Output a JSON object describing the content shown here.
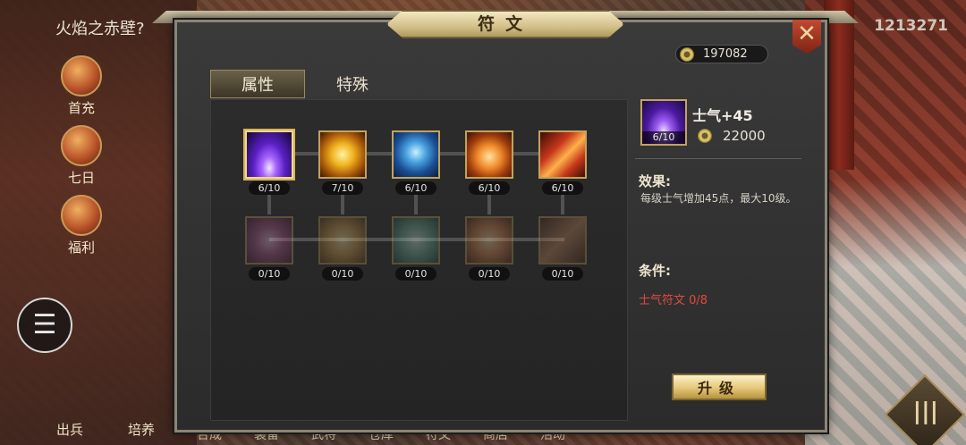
{
  "background": {
    "top_left_text": "火焰之赤壁?",
    "top_right_number": "1213271",
    "side_buttons": [
      "首充",
      "七日",
      "福利"
    ],
    "bottom_left_buttons": [
      "出兵",
      "培养"
    ],
    "bottom_nav": [
      "合成",
      "装备",
      "武将",
      "仓库",
      "符文",
      "商店",
      "活动"
    ]
  },
  "window": {
    "title": "符文",
    "currency": "197082"
  },
  "tabs": [
    {
      "label": "属性",
      "active": true
    },
    {
      "label": "特殊",
      "active": false
    }
  ],
  "runes_row1": [
    {
      "name": "purple-aura-rune",
      "level": "6/10"
    },
    {
      "name": "running-warrior-rune",
      "level": "7/10"
    },
    {
      "name": "shield-rune",
      "level": "6/10"
    },
    {
      "name": "fire-warrior-rune",
      "level": "6/10"
    },
    {
      "name": "flaming-sword-rune",
      "level": "6/10"
    }
  ],
  "runes_row2": [
    {
      "name": "purple-aura-rune-locked",
      "level": "0/10"
    },
    {
      "name": "running-warrior-rune-locked",
      "level": "0/10"
    },
    {
      "name": "shield-rune-locked",
      "level": "0/10"
    },
    {
      "name": "fire-warrior-rune-locked",
      "level": "0/10"
    },
    {
      "name": "flaming-sword-rune-locked",
      "level": "0/10"
    }
  ],
  "detail": {
    "level": "6/10",
    "name": "士气+45",
    "cost": "22000",
    "effect_label": "效果:",
    "effect_text": "每级士气增加45点，最大10级。",
    "condition_label": "条件:",
    "condition_text": "士气符文 0/8",
    "upgrade_label": "升级"
  },
  "colors": {
    "gold_border": "#c2a35e",
    "condition_red": "#e24b3c",
    "panel_bg": "#2b2b2b"
  }
}
